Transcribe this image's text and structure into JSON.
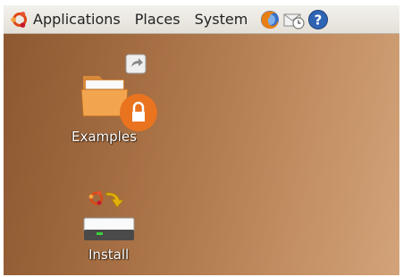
{
  "panel": {
    "menus": [
      {
        "label": "Applications"
      },
      {
        "label": "Places"
      },
      {
        "label": "System"
      }
    ],
    "launchers": [
      {
        "icon": "firefox-icon"
      },
      {
        "icon": "email-icon"
      },
      {
        "icon": "help-icon"
      }
    ]
  },
  "desktop": {
    "background_from": "#8d5830",
    "background_to": "#d3a379",
    "icons": [
      {
        "label": "Examples",
        "icon": "folder-icon",
        "emblems": [
          "symlink-emblem",
          "lock-emblem"
        ]
      },
      {
        "label": "Install",
        "icon": "install-drive-icon"
      }
    ]
  }
}
